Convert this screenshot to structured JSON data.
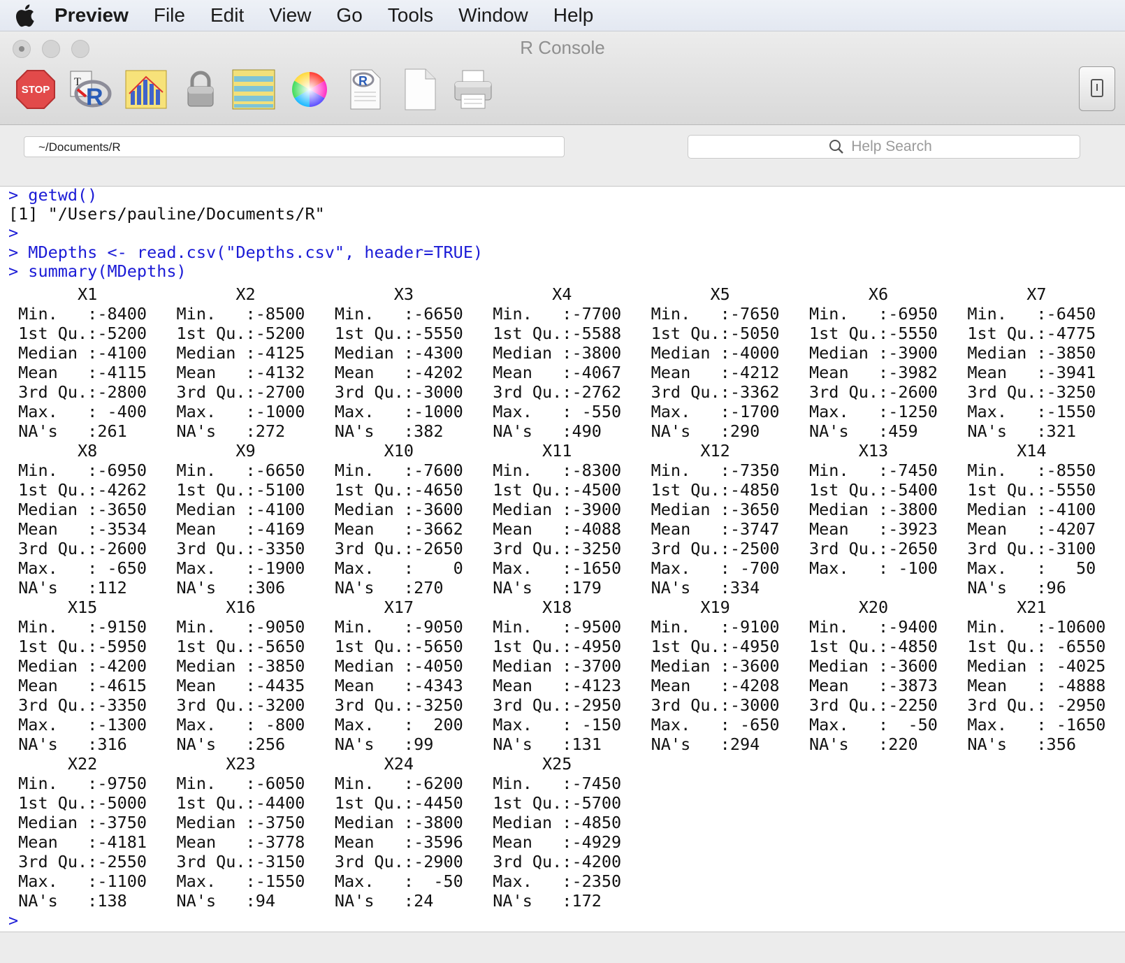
{
  "menubar": {
    "app": "Preview",
    "items": [
      "File",
      "Edit",
      "View",
      "Go",
      "Tools",
      "Window",
      "Help"
    ]
  },
  "window": {
    "title": "R Console",
    "toolbar_icons": [
      "stop-icon",
      "source-script-icon",
      "quartz-plot-icon",
      "lock-icon",
      "data-editor-icon",
      "color-wheel-icon",
      "r-document-icon",
      "new-document-icon",
      "print-icon"
    ]
  },
  "pathbar": {
    "path": "~/Documents/R",
    "search_placeholder": "Help Search"
  },
  "console": {
    "lines": [
      {
        "text": "> getwd()",
        "kind": "cmd"
      },
      {
        "text": "[1] \"/Users/pauline/Documents/R\"",
        "kind": "out"
      },
      {
        "text": ">",
        "kind": "prompt"
      },
      {
        "text": "> MDepths <- read.csv(\"Depths.csv\", header=TRUE)",
        "kind": "cmd"
      },
      {
        "text": "> summary(MDepths)",
        "kind": "cmd"
      }
    ],
    "summary_rows": [
      "       X1              X2              X3              X4              X5              X6              X7",
      " Min.   :-8400   Min.   :-8500   Min.   :-6650   Min.   :-7700   Min.   :-7650   Min.   :-6950   Min.   :-6450",
      " 1st Qu.:-5200   1st Qu.:-5200   1st Qu.:-5550   1st Qu.:-5588   1st Qu.:-5050   1st Qu.:-5550   1st Qu.:-4775",
      " Median :-4100   Median :-4125   Median :-4300   Median :-3800   Median :-4000   Median :-3900   Median :-3850",
      " Mean   :-4115   Mean   :-4132   Mean   :-4202   Mean   :-4067   Mean   :-4212   Mean   :-3982   Mean   :-3941",
      " 3rd Qu.:-2800   3rd Qu.:-2700   3rd Qu.:-3000   3rd Qu.:-2762   3rd Qu.:-3362   3rd Qu.:-2600   3rd Qu.:-3250",
      " Max.   : -400   Max.   :-1000   Max.   :-1000   Max.   : -550   Max.   :-1700   Max.   :-1250   Max.   :-1550",
      " NA's   :261     NA's   :272     NA's   :382     NA's   :490     NA's   :290     NA's   :459     NA's   :321",
      "       X8              X9             X10             X11             X12             X13             X14",
      " Min.   :-6950   Min.   :-6650   Min.   :-7600   Min.   :-8300   Min.   :-7350   Min.   :-7450   Min.   :-8550",
      " 1st Qu.:-4262   1st Qu.:-5100   1st Qu.:-4650   1st Qu.:-4500   1st Qu.:-4850   1st Qu.:-5400   1st Qu.:-5550",
      " Median :-3650   Median :-4100   Median :-3600   Median :-3900   Median :-3650   Median :-3800   Median :-4100",
      " Mean   :-3534   Mean   :-4169   Mean   :-3662   Mean   :-4088   Mean   :-3747   Mean   :-3923   Mean   :-4207",
      " 3rd Qu.:-2600   3rd Qu.:-3350   3rd Qu.:-2650   3rd Qu.:-3250   3rd Qu.:-2500   3rd Qu.:-2650   3rd Qu.:-3100",
      " Max.   : -650   Max.   :-1900   Max.   :    0   Max.   :-1650   Max.   : -700   Max.   : -100   Max.   :   50",
      " NA's   :112     NA's   :306     NA's   :270     NA's   :179     NA's   :334                     NA's   :96",
      "      X15             X16             X17             X18             X19             X20             X21",
      " Min.   :-9150   Min.   :-9050   Min.   :-9050   Min.   :-9500   Min.   :-9100   Min.   :-9400   Min.   :-10600",
      " 1st Qu.:-5950   1st Qu.:-5650   1st Qu.:-5650   1st Qu.:-4950   1st Qu.:-4950   1st Qu.:-4850   1st Qu.: -6550",
      " Median :-4200   Median :-3850   Median :-4050   Median :-3700   Median :-3600   Median :-3600   Median : -4025",
      " Mean   :-4615   Mean   :-4435   Mean   :-4343   Mean   :-4123   Mean   :-4208   Mean   :-3873   Mean   : -4888",
      " 3rd Qu.:-3350   3rd Qu.:-3200   3rd Qu.:-3250   3rd Qu.:-2950   3rd Qu.:-3000   3rd Qu.:-2250   3rd Qu.: -2950",
      " Max.   :-1300   Max.   : -800   Max.   :  200   Max.   : -150   Max.   : -650   Max.   :  -50   Max.   : -1650",
      " NA's   :316     NA's   :256     NA's   :99      NA's   :131     NA's   :294     NA's   :220     NA's   :356",
      "      X22             X23             X24             X25",
      " Min.   :-9750   Min.   :-6050   Min.   :-6200   Min.   :-7450",
      " 1st Qu.:-5000   1st Qu.:-4400   1st Qu.:-4450   1st Qu.:-5700",
      " Median :-3750   Median :-3750   Median :-3800   Median :-4850",
      " Mean   :-4181   Mean   :-3778   Mean   :-3596   Mean   :-4929",
      " 3rd Qu.:-2550   3rd Qu.:-3150   3rd Qu.:-2900   3rd Qu.:-4200",
      " Max.   :-1100   Max.   :-1550   Max.   :  -50   Max.   :-2350",
      " NA's   :138     NA's   :94      NA's   :24      NA's   :172"
    ],
    "final_prompt": ">"
  },
  "colors": {
    "command": "#1b1bd6",
    "output": "#111111"
  }
}
